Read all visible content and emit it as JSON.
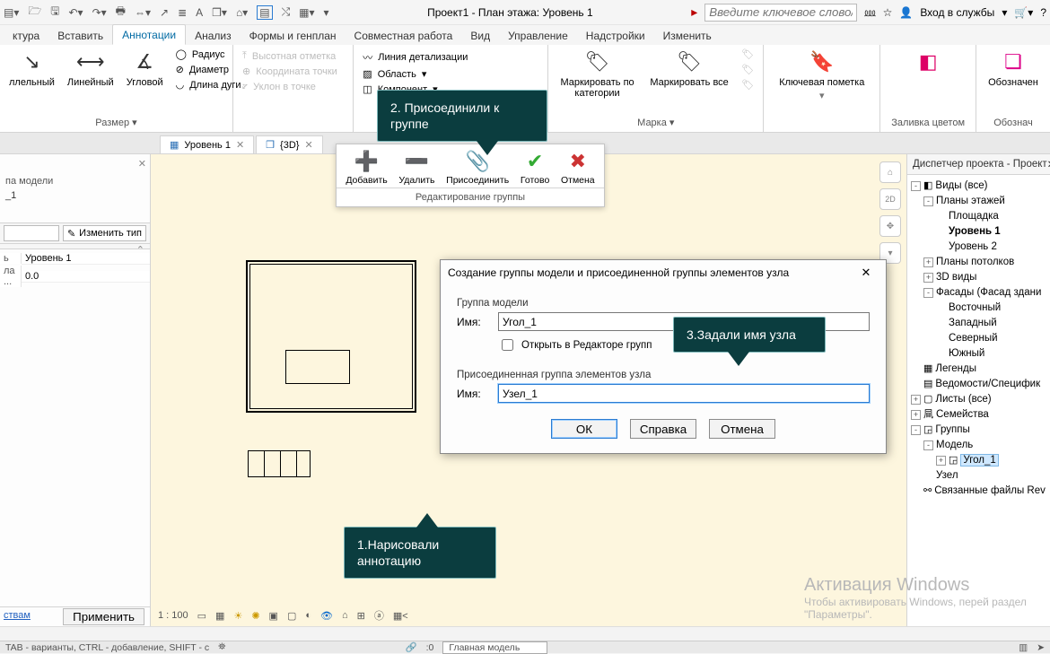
{
  "title": "Проект1 - План этажа: Уровень 1",
  "search_placeholder": "Введите ключевое слово/фразу",
  "login": "Вход в службы",
  "menus": [
    "ктура",
    "Вставить",
    "Аннотации",
    "Анализ",
    "Формы и генплан",
    "Совместная работа",
    "Вид",
    "Управление",
    "Надстройки",
    "Изменить"
  ],
  "active_menu_index": 2,
  "ribbon": {
    "dim_big": [
      "ллельный",
      "Линейный",
      "Угловой"
    ],
    "dim_small": [
      "Радиус",
      "Диаметр",
      "Длина дуги"
    ],
    "dim_caption": "Размер ▾",
    "detail_small_dis": [
      "Высотная отметка",
      "Координата точки",
      "Уклон  в точке"
    ],
    "detail2": [
      "Линия детализации",
      "Область",
      "Компонент"
    ],
    "tag_big": [
      "Маркировать по категории",
      "Маркировать все"
    ],
    "mark_caption": "Марка ▾",
    "keynote": "Ключевая пометка",
    "fill_caption": "Заливка цветом",
    "obo_caption": "Обознач",
    "obo_big": "Обозначен"
  },
  "viewtabs": [
    {
      "icon": "▦",
      "label": "Уровень 1"
    },
    {
      "icon": "❒",
      "label": "{3D}"
    }
  ],
  "group_editor": {
    "tools": [
      {
        "label": "Добавить"
      },
      {
        "label": "Удалить"
      },
      {
        "label": "Присоединить"
      },
      {
        "label": "Готово"
      },
      {
        "label": "Отмена"
      }
    ],
    "caption": "Редактирование группы"
  },
  "props": {
    "type_header": "па модели",
    "type_line": "_1",
    "edit_type": "Изменить тип",
    "rows": [
      {
        "k": "ь",
        "v": "Уровень 1"
      },
      {
        "k": "ла ...",
        "v": "0.0"
      }
    ],
    "apply": "Применить",
    "bottom_link": "ствам"
  },
  "dialog": {
    "title": "Создание группы модели и присоединенной группы элементов узла",
    "grp1": "Группа модели",
    "name_label": "Имя:",
    "name1": "Угол_1",
    "open_editor": "Открыть в Редакторе групп",
    "grp2": "Присоединенная группа элементов узла",
    "name2": "Узел_1",
    "ok": "ОК",
    "help": "Справка",
    "cancel": "Отмена"
  },
  "callouts": {
    "c1": "1.Нарисовали аннотацию",
    "c2": "2. Присоединили к группе",
    "c3": "3.Задали имя узла"
  },
  "browser": {
    "header": "Диспетчер проекта - Проект",
    "tree": [
      {
        "lvl": 0,
        "exp": "-",
        "ico": "",
        "txt": "Виды (все)",
        "pre": "◧"
      },
      {
        "lvl": 1,
        "exp": "-",
        "txt": "Планы этажей"
      },
      {
        "lvl": 2,
        "txt": "Площадка"
      },
      {
        "lvl": 2,
        "txt": "Уровень 1",
        "bold": true
      },
      {
        "lvl": 2,
        "txt": "Уровень 2"
      },
      {
        "lvl": 1,
        "exp": "+",
        "txt": "Планы потолков"
      },
      {
        "lvl": 1,
        "exp": "+",
        "txt": "3D виды"
      },
      {
        "lvl": 1,
        "exp": "-",
        "txt": "Фасады (Фасад здани"
      },
      {
        "lvl": 2,
        "txt": "Восточный"
      },
      {
        "lvl": 2,
        "txt": "Западный"
      },
      {
        "lvl": 2,
        "txt": "Северный"
      },
      {
        "lvl": 2,
        "txt": "Южный"
      },
      {
        "lvl": 0,
        "ico": "▦",
        "txt": "Легенды"
      },
      {
        "lvl": 0,
        "ico": "▤",
        "txt": "Ведомости/Специфик"
      },
      {
        "lvl": 0,
        "exp": "+",
        "ico": "▢",
        "txt": "Листы (все)"
      },
      {
        "lvl": 0,
        "exp": "+",
        "ico": "凬",
        "txt": "Семейства"
      },
      {
        "lvl": 0,
        "exp": "-",
        "ico": "◲",
        "txt": "Группы"
      },
      {
        "lvl": 1,
        "exp": "-",
        "txt": "Модель"
      },
      {
        "lvl": 2,
        "exp": "+",
        "ico": "◲",
        "txt": "Угол_1",
        "hl": true
      },
      {
        "lvl": 1,
        "txt": "Узел"
      },
      {
        "lvl": 0,
        "ico": "⚯",
        "txt": "Связанные файлы Rev"
      }
    ]
  },
  "viewbar": {
    "scale": "1 : 100"
  },
  "status": {
    "left": "TAB - варианты, CTRL - добавление, SHIFT - с",
    "mid": ":0",
    "model": "Главная модель"
  },
  "activation": {
    "t1": "Активация Windows",
    "t2": "Чтобы активировать Windows, перей раздел \"Параметры\"."
  }
}
